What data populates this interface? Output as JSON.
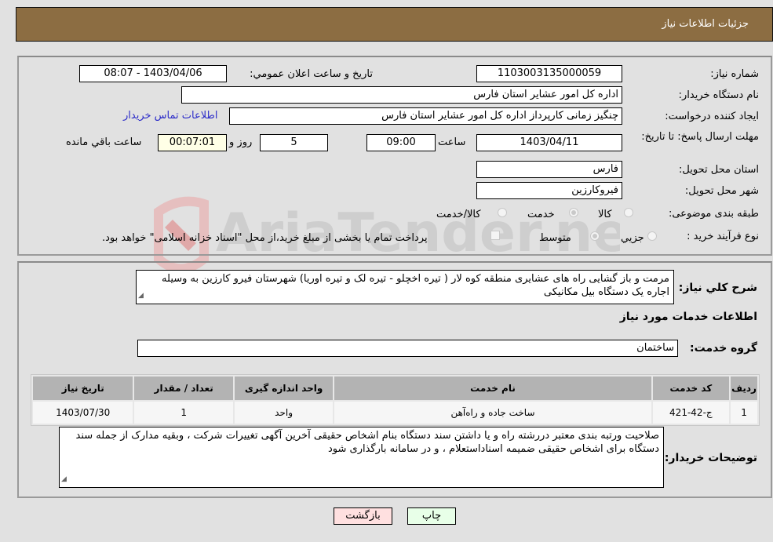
{
  "header": {
    "title": "جزئیات اطلاعات نیاز"
  },
  "form": {
    "need_number": {
      "label": "شماره نیاز:",
      "value": "1103003135000059"
    },
    "announce_datetime": {
      "label": "تاریخ و ساعت اعلان عمومي:",
      "value": "1403/04/06 - 08:07"
    },
    "buyer_org": {
      "label": "نام دستگاه خریدار:",
      "value": "اداره کل امور عشایر استان فارس"
    },
    "requester": {
      "label": "ایجاد کننده درخواست:",
      "value": "چنگیز زمانی کارپرداز اداره کل امور عشایر استان فارس",
      "contact_link": "اطلاعات تماس خریدار"
    },
    "deadline": {
      "label": "مهلت ارسال پاسخ: تا تاریخ:",
      "date": "1403/04/11",
      "time_label": "ساعت",
      "time": "09:00",
      "days": "5",
      "days_label": "روز و",
      "remaining": "00:07:01",
      "remaining_label": "ساعت باقي مانده"
    },
    "delivery_province": {
      "label": "استان محل تحویل:",
      "value": "فارس"
    },
    "delivery_city": {
      "label": "شهر محل تحویل:",
      "value": "فیروکارزین"
    },
    "category": {
      "label": "طبقه بندی موضوعی:",
      "options": [
        "کالا",
        "خدمت",
        "کالا/خدمت"
      ],
      "selected": "خدمت"
    },
    "purchase_type": {
      "label": "نوع فرآیند خرید :",
      "options": [
        "جزيي",
        "متوسط"
      ],
      "selected": "متوسط",
      "treasury_note": "پرداخت تمام یا بخشی از مبلغ خرید،از محل \"اسناد خزانه اسلامی\" خواهد بود."
    }
  },
  "description": {
    "label": "شرح کلي نیاز:",
    "value": "مرمت و باز گشایی راه های  عشایری  منطقه کوه لار ( تیره اخچلو - تیره لک و تیره اوریا) شهرستان فیرو کارزین   به وسیله اجاره یک دستگاه بیل مکانیکی"
  },
  "services": {
    "section_title": "اطلاعات خدمات مورد نیاز",
    "group_label": "گروه خدمت:",
    "group_value": "ساختمان",
    "table": {
      "headers": [
        "ردیف",
        "کد خدمت",
        "نام خدمت",
        "واحد اندازه گیری",
        "تعداد / مقدار",
        "تاریخ نیاز"
      ],
      "rows": [
        [
          "1",
          "ج-42-421",
          "ساخت جاده و راه‌آهن",
          "واحد",
          "1",
          "1403/07/30"
        ]
      ]
    }
  },
  "buyer_notes": {
    "label": "توضیحات خریدار:",
    "value": "صلاحیت ورتبه بندی معتبر دررشته راه و یا داشتن سند دستگاه  بنام اشخاص حقیقی  آخرین آگهی تغییرات شرکت ، وبقیه مدارک  از جمله سند دستگاه برای اشخاص حقیقی ضمیمه اسناداستعلام ، و در سامانه بارگذاری شود"
  },
  "buttons": {
    "print": "چاپ",
    "back": "بازگشت"
  },
  "watermark": {
    "text": "AriaTender.net"
  },
  "colors": {
    "header_bg": "#8c6d42",
    "back_btn_bg": "#ffe0e0",
    "print_btn_bg": "#e8ffe8",
    "link": "#2c2cc8"
  }
}
